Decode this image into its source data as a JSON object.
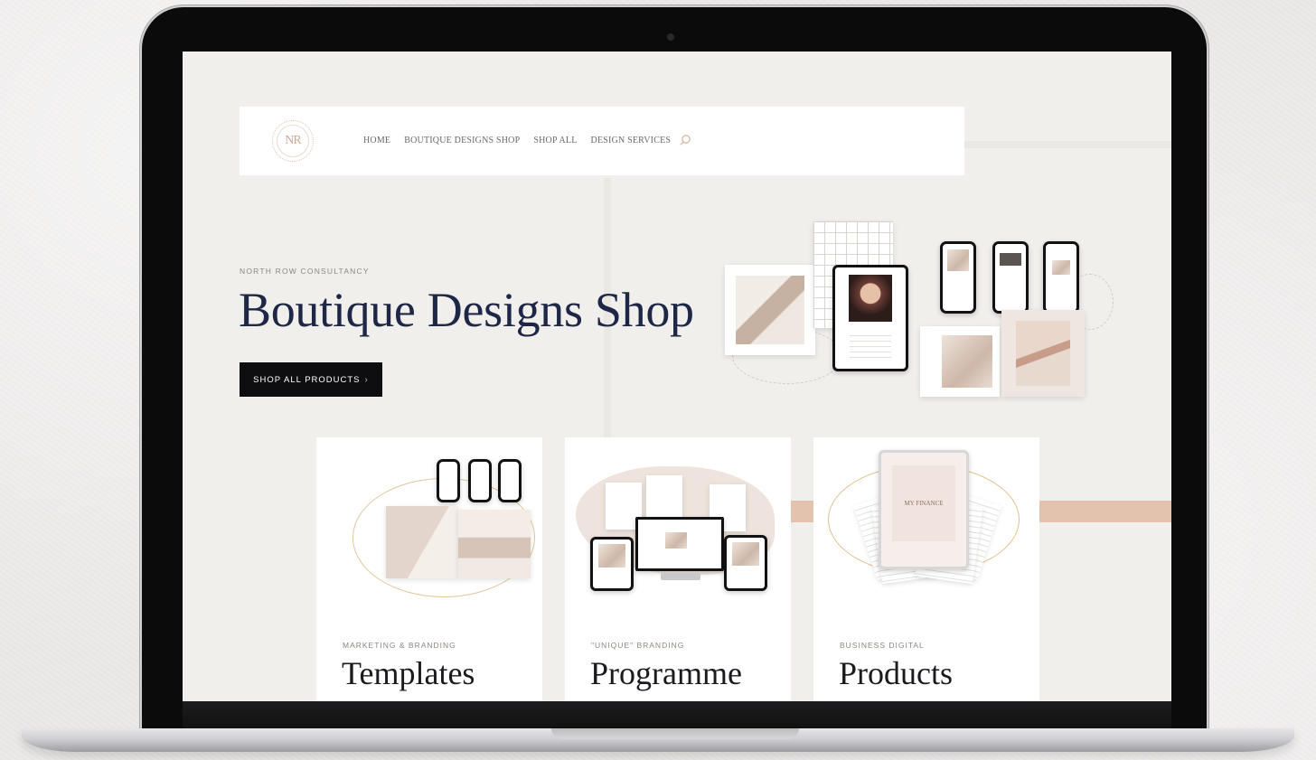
{
  "nav": {
    "logo_text": "NR",
    "links": [
      "HOME",
      "BOUTIQUE DESIGNS SHOP",
      "SHOP ALL",
      "DESIGN SERVICES"
    ]
  },
  "hero": {
    "eyebrow": "NORTH ROW CONSULTANCY",
    "title": "Boutique Designs Shop",
    "cta_label": "SHOP ALL PRODUCTS",
    "cta_chevron": "›"
  },
  "cards": [
    {
      "eyebrow": "MARKETING & BRANDING",
      "title": "Templates"
    },
    {
      "eyebrow": "\"UNIQUE\" BRANDING",
      "title": "Programme"
    },
    {
      "eyebrow": "BUSINESS DIGITAL",
      "title": "Products"
    }
  ],
  "mockup_text": {
    "finance_cover": "MY FINANCE"
  },
  "colors": {
    "title_navy": "#1f2747",
    "button_black": "#0e0e10",
    "page_bg": "#f1efec",
    "accent_peach": "#e3c3ae",
    "search_gold": "#d6b9a2"
  },
  "icons": {
    "search": "search-icon"
  }
}
